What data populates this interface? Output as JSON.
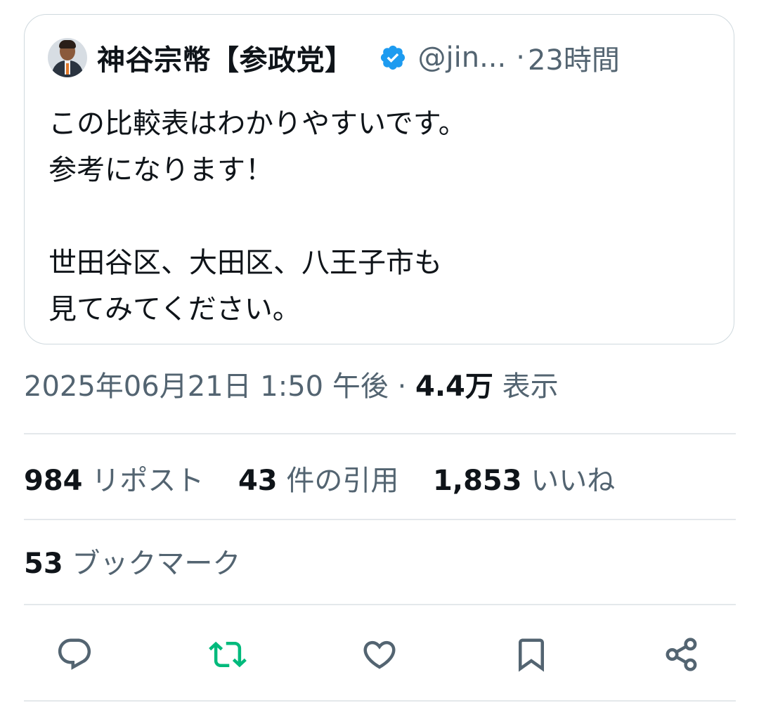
{
  "quoted_tweet": {
    "author_name": "神谷宗幣【参政党】",
    "handle": "@jin...",
    "separator": "·",
    "time": "23時間",
    "text_lines": [
      "この比較表はわかりやすいです。",
      "参考になります！",
      "",
      "世田谷区、大田区、八王子市も",
      "見てみてください。"
    ]
  },
  "meta": {
    "timestamp": "2025年06月21日 1:50 午後",
    "separator": "·",
    "views_count": "4.4万",
    "views_label": "表示"
  },
  "stats": {
    "reposts_count": "984",
    "reposts_label": "リポスト",
    "quotes_count": "43",
    "quotes_label": "件の引用",
    "likes_count": "1,853",
    "likes_label": "いいね",
    "bookmarks_count": "53",
    "bookmarks_label": "ブックマーク"
  },
  "actions": [
    {
      "name": "reply",
      "icon": "reply-icon",
      "color": "#536471"
    },
    {
      "name": "repost",
      "icon": "repost-icon",
      "color": "#00ba7c"
    },
    {
      "name": "like",
      "icon": "heart-icon",
      "color": "#536471"
    },
    {
      "name": "bookmark",
      "icon": "bookmark-icon",
      "color": "#536471"
    },
    {
      "name": "share",
      "icon": "share-icon",
      "color": "#536471"
    }
  ],
  "colors": {
    "verified": "#1d9bf0",
    "secondary_text": "#536471",
    "repost_active": "#00ba7c"
  }
}
